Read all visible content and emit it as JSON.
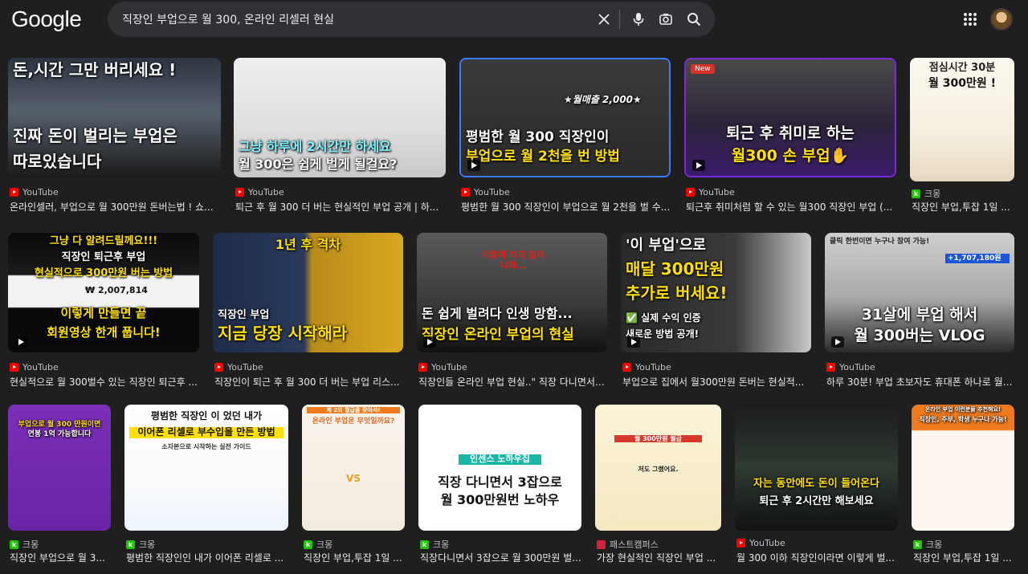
{
  "header": {
    "logo": "Google",
    "search_value": "직장인 부업으로 월 300, 온라인 리셀러 현실"
  },
  "row1": [
    {
      "thumb_lines": [
        "돈,시간 그만 버리세요 !",
        "진짜 돈이 벌리는 부업은",
        "따로있습니다"
      ],
      "source": "YouTube",
      "title": "온라인셀러, 부업으로 월 300만원 돈버는법 ! 쇼..."
    },
    {
      "thumb_lines": [
        "그냥 하루에 2시간만 하세요",
        "월 300은 쉽게 벌게 될걸요?"
      ],
      "source": "YouTube",
      "title": "퇴근 후 월 300 더 버는 현실적인 부업 공개 | 하..."
    },
    {
      "thumb_lines": [
        "★월매출 2,000★",
        "평범한 월 300 직장인이",
        "부업으로 월 2천을 번 방법"
      ],
      "source": "YouTube",
      "title": "평범한 월 300 직장인이 부업으로 월 2천을 벌 수..."
    },
    {
      "badge": "New",
      "thumb_lines": [
        "퇴근 후 취미로 하는",
        "월300 손 부업✋"
      ],
      "source": "YouTube",
      "title": "퇴근후 취미처럼 할 수 있는 월300 직장인 부업 (..."
    },
    {
      "thumb_lines": [
        "점심시간 30분",
        "월 300만원 !"
      ],
      "source": "크몽",
      "title": "직장인 부업,투잡 1일 ..."
    }
  ],
  "row2": [
    {
      "thumb_lines": [
        "그냥 다 알려드릴께요!!!",
        "직장인 퇴근후 부업",
        "현실적으로 300만원 버는 방법",
        "₩ 2,007,814",
        "이렇게 만들면 끝",
        "회원영상 한개 풉니다!"
      ],
      "source": "YouTube",
      "title": "현실적으로 월 300벌수 있는 직장인 퇴근후 ..."
    },
    {
      "thumb_lines": [
        "1년 후 격차",
        "직장인 부업",
        "지금 당장 시작해라"
      ],
      "source": "YouTube",
      "title": "직장인이 퇴근 후 월 300 더 버는 부업 리스..."
    },
    {
      "thumb_lines": [
        "이렇게 하지 말라니까...",
        "돈 쉽게 벌려다 인생 망함...",
        "직장인 온라인 부업의 현실"
      ],
      "source": "YouTube",
      "title": "직장인들 온라인 부업 현실..\" 직장 다니면서 ..."
    },
    {
      "thumb_lines": [
        "'이 부업'으로",
        "매달 300만원",
        "추가로 버세요!",
        "✅ 실제 수익 인증",
        "새로운 방법 공개!"
      ],
      "source": "YouTube",
      "title": "부업으로 집에서 월300만원 돈버는 현실적..."
    },
    {
      "thumb_lines": [
        "클릭 한번이면 누구나 참여 가능!",
        "+1,707,180원",
        "31살에 부업 해서",
        "월 300버는 VLOG"
      ],
      "source": "YouTube",
      "title": "하루 30분! 부업 초보자도 휴대폰 하나로 월 ..."
    }
  ],
  "row3": [
    {
      "thumb_lines": [
        "부업으로 월 300 만원이면",
        "연봉 1억 가능합니다"
      ],
      "source": "크몽",
      "title": "직장인 부업으로 월 3..."
    },
    {
      "thumb_lines": [
        "평범한 직장인 이 었던 내가",
        "이어폰 리셀로 부수입을 만든 방법",
        "소자본으로 시작하는 실전 가이드"
      ],
      "source": "크몽",
      "title": "평범한 직장인인 내가 이어폰 리셀로 ..."
    },
    {
      "thumb_lines": [
        "제 2의 월급을 찾아서!",
        "온라인 부업은 무엇일까요?",
        "VS"
      ],
      "source": "크몽",
      "title": "직장인 부업,투잡 1일 ..."
    },
    {
      "thumb_lines": [
        "인센스 노하우집",
        "직장 다니면서 3잡으로",
        "월 300만원번 노하우"
      ],
      "source": "크몽",
      "title": "직장다니면서 3잡으로 월 300만원 벌..."
    },
    {
      "thumb_lines": [
        "월 300만원 월급",
        "저도 그랬어요."
      ],
      "source": "패스트캠퍼스",
      "title": "가장 현실적인 직장인 부업 ..."
    },
    {
      "thumb_lines": [
        "자는 동안에도 돈이 들어온다",
        "퇴근 후 2시간만 해보세요"
      ],
      "source": "YouTube",
      "title": "월 300 이하 직장인이라면 이렇게 벌..."
    },
    {
      "thumb_lines": [
        "온라인 부업 이런분들 추천해요!",
        "직장인, 주부, 학생 누구나 가능!"
      ],
      "source": "크몽",
      "title": "직장인 부업,투잡 1일 ..."
    }
  ]
}
